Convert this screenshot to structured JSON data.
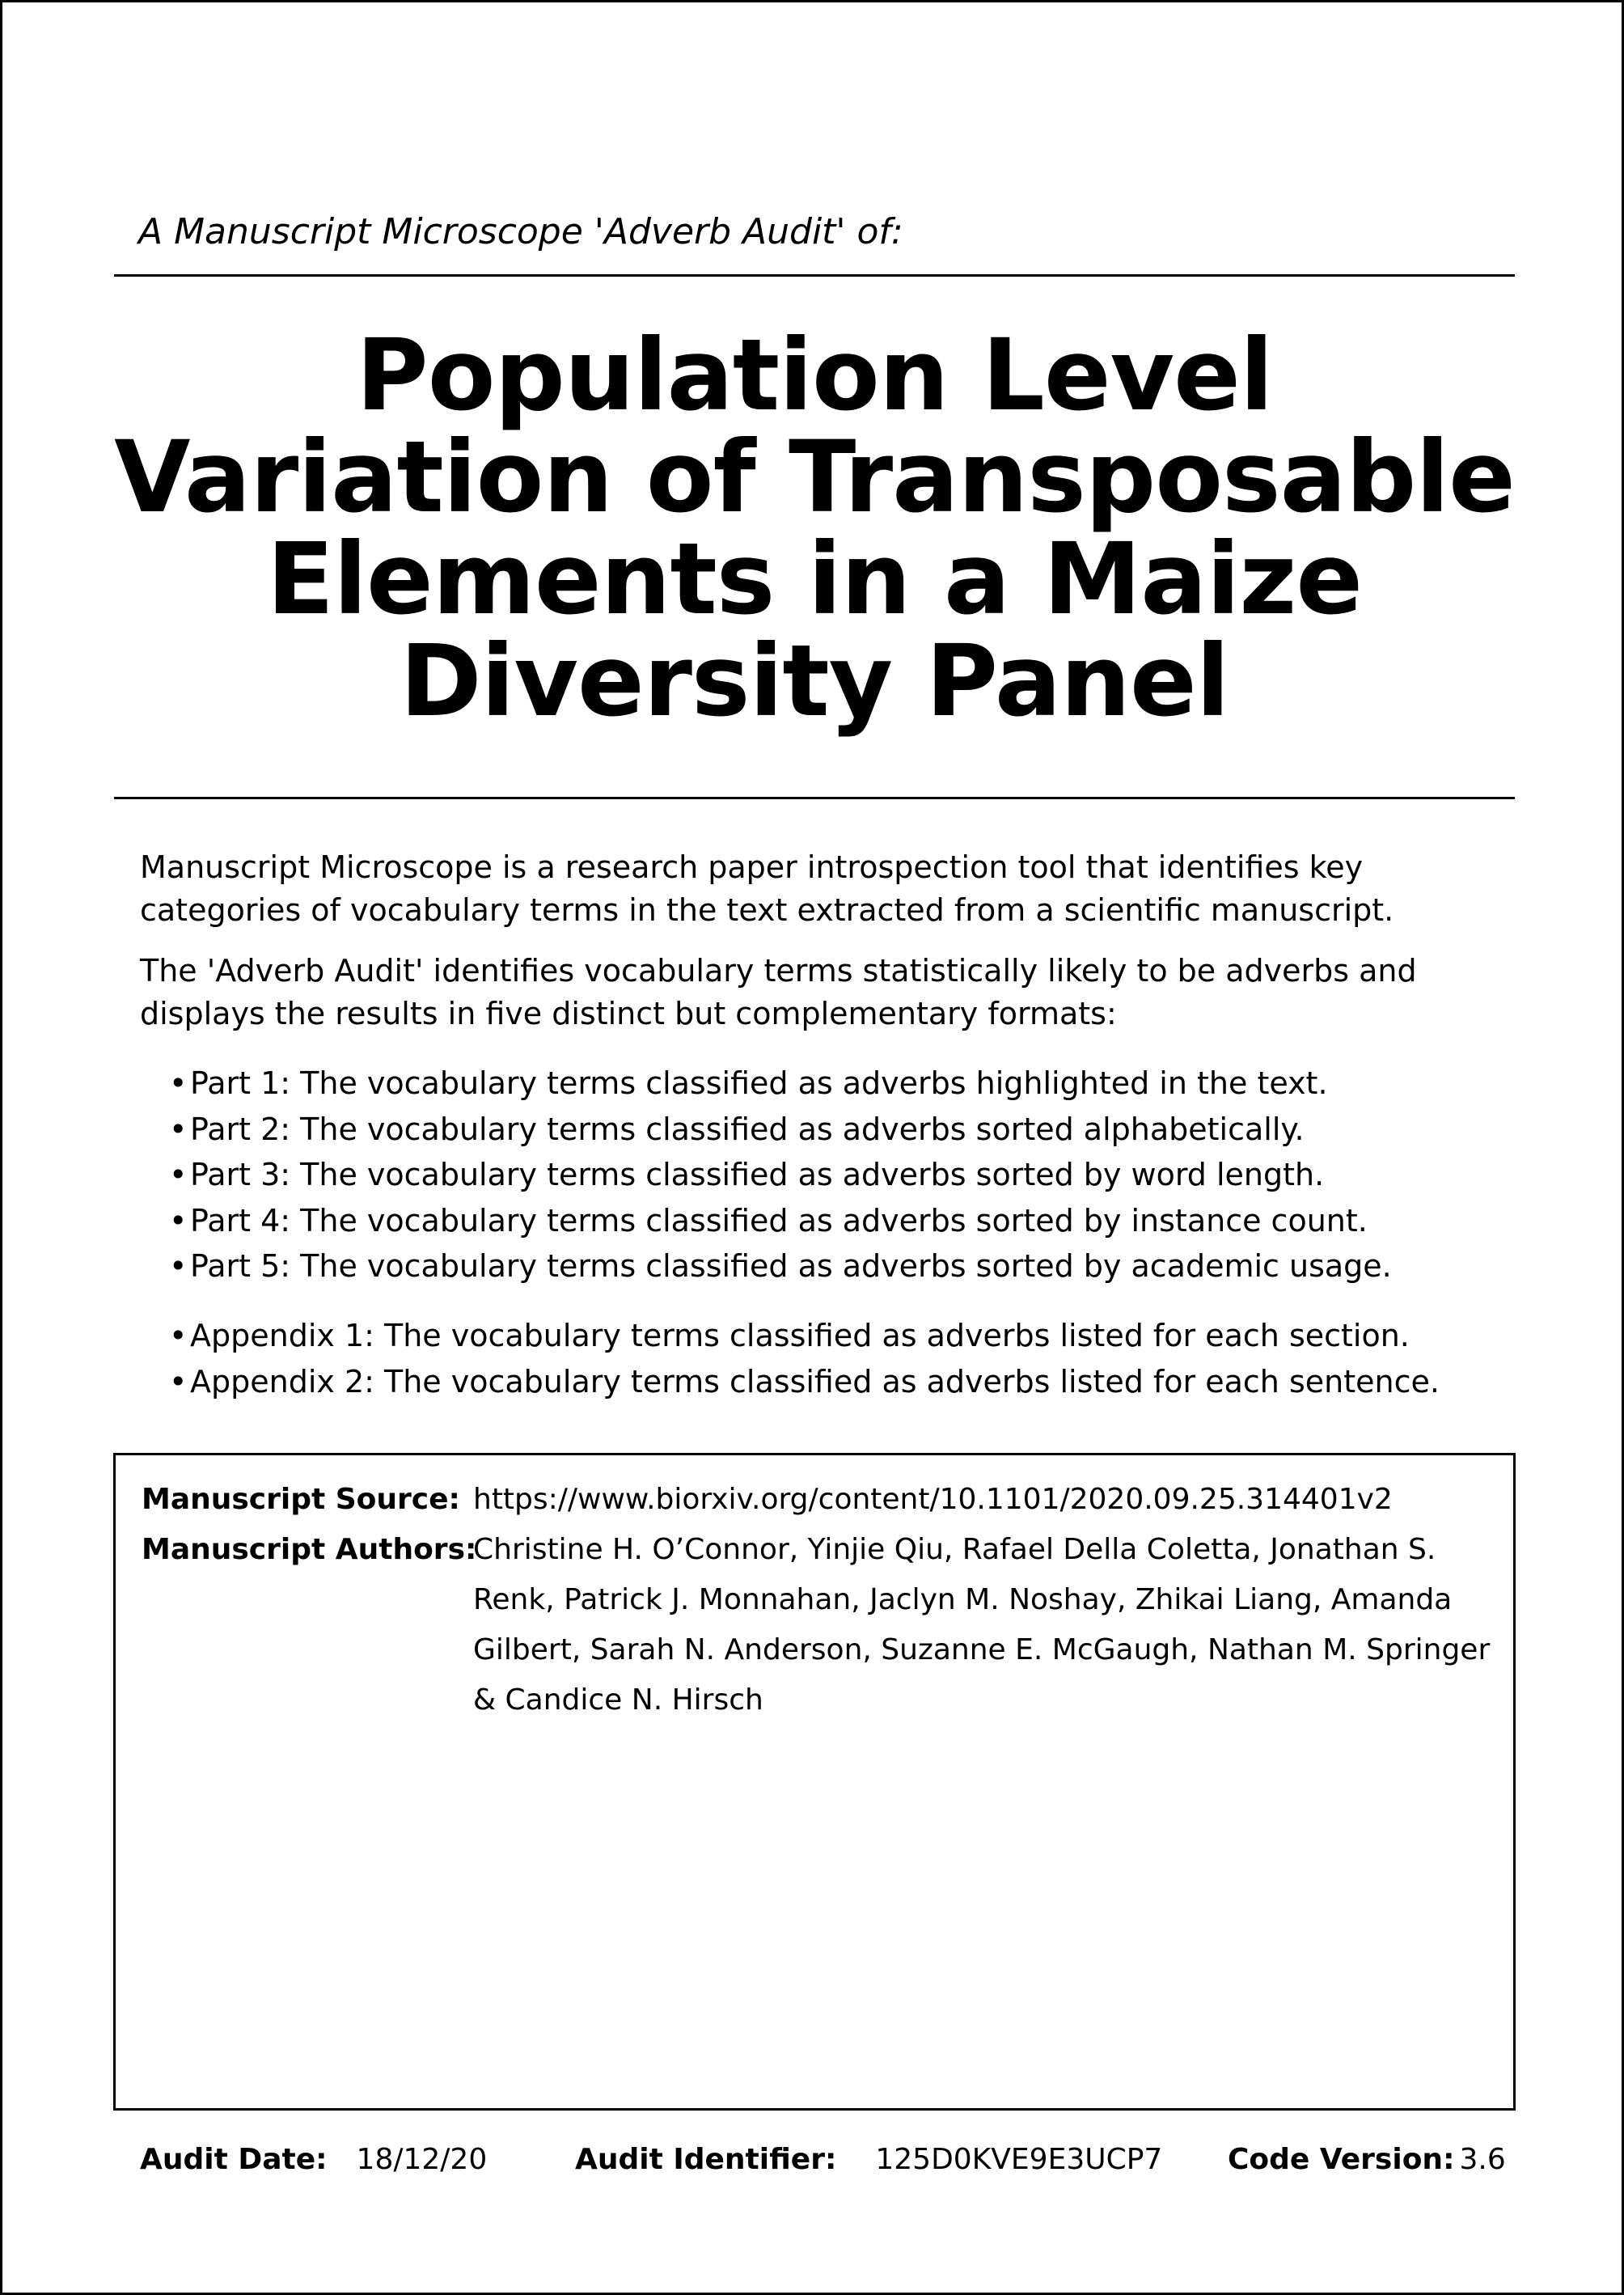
{
  "header": {
    "kicker": "A Manuscript Microscope 'Adverb Audit' of:",
    "title_lines": [
      "Population Level",
      "Variation of Transposable",
      "Elements in a Maize",
      "Diversity Panel"
    ]
  },
  "intro": {
    "paragraph_1": "Manuscript Microscope is a research paper introspection tool that identifies key categories of vocabulary terms in the text extracted from a scientific manuscript.",
    "paragraph_2": "The 'Adverb Audit' identifies vocabulary terms statistically likely to be adverbs and displays the results in five distinct but complementary formats:"
  },
  "parts": [
    "Part 1: The vocabulary terms classified as adverbs highlighted in the text.",
    "Part 2: The vocabulary terms classified as adverbs sorted alphabetically.",
    "Part 3: The vocabulary terms classified as adverbs sorted by word length.",
    "Part 4: The vocabulary terms classified as adverbs sorted by instance count.",
    "Part 5: The vocabulary terms classified as adverbs sorted by academic usage."
  ],
  "appendices": [
    "Appendix 1: The vocabulary terms classified as adverbs listed for each section.",
    "Appendix 2: The vocabulary terms classified as adverbs listed for each sentence."
  ],
  "bullet_glyph": "•",
  "manuscript": {
    "source_label": "Manuscript Source:",
    "source_value": "https://www.biorxiv.org/content/10.1101/2020.09.25.314401v2",
    "authors_label": "Manuscript Authors:",
    "authors_value": "Christine H. O’Connor, Yinjie Qiu, Rafael Della Coletta, Jonathan S. Renk, Patrick J. Monnahan, Jaclyn M. Noshay, Zhikai Liang, Amanda Gilbert, Sarah N. Anderson, Suzanne E. McGaugh, Nathan M. Springer & Candice N. Hirsch"
  },
  "footer": {
    "audit_date_label": "Audit Date:",
    "audit_date_value": "18/12/20",
    "audit_id_label": "Audit Identifier:",
    "audit_id_value": "125D0KVE9E3UCP7",
    "code_version_label": "Code Version:",
    "code_version_value": "3.6"
  }
}
